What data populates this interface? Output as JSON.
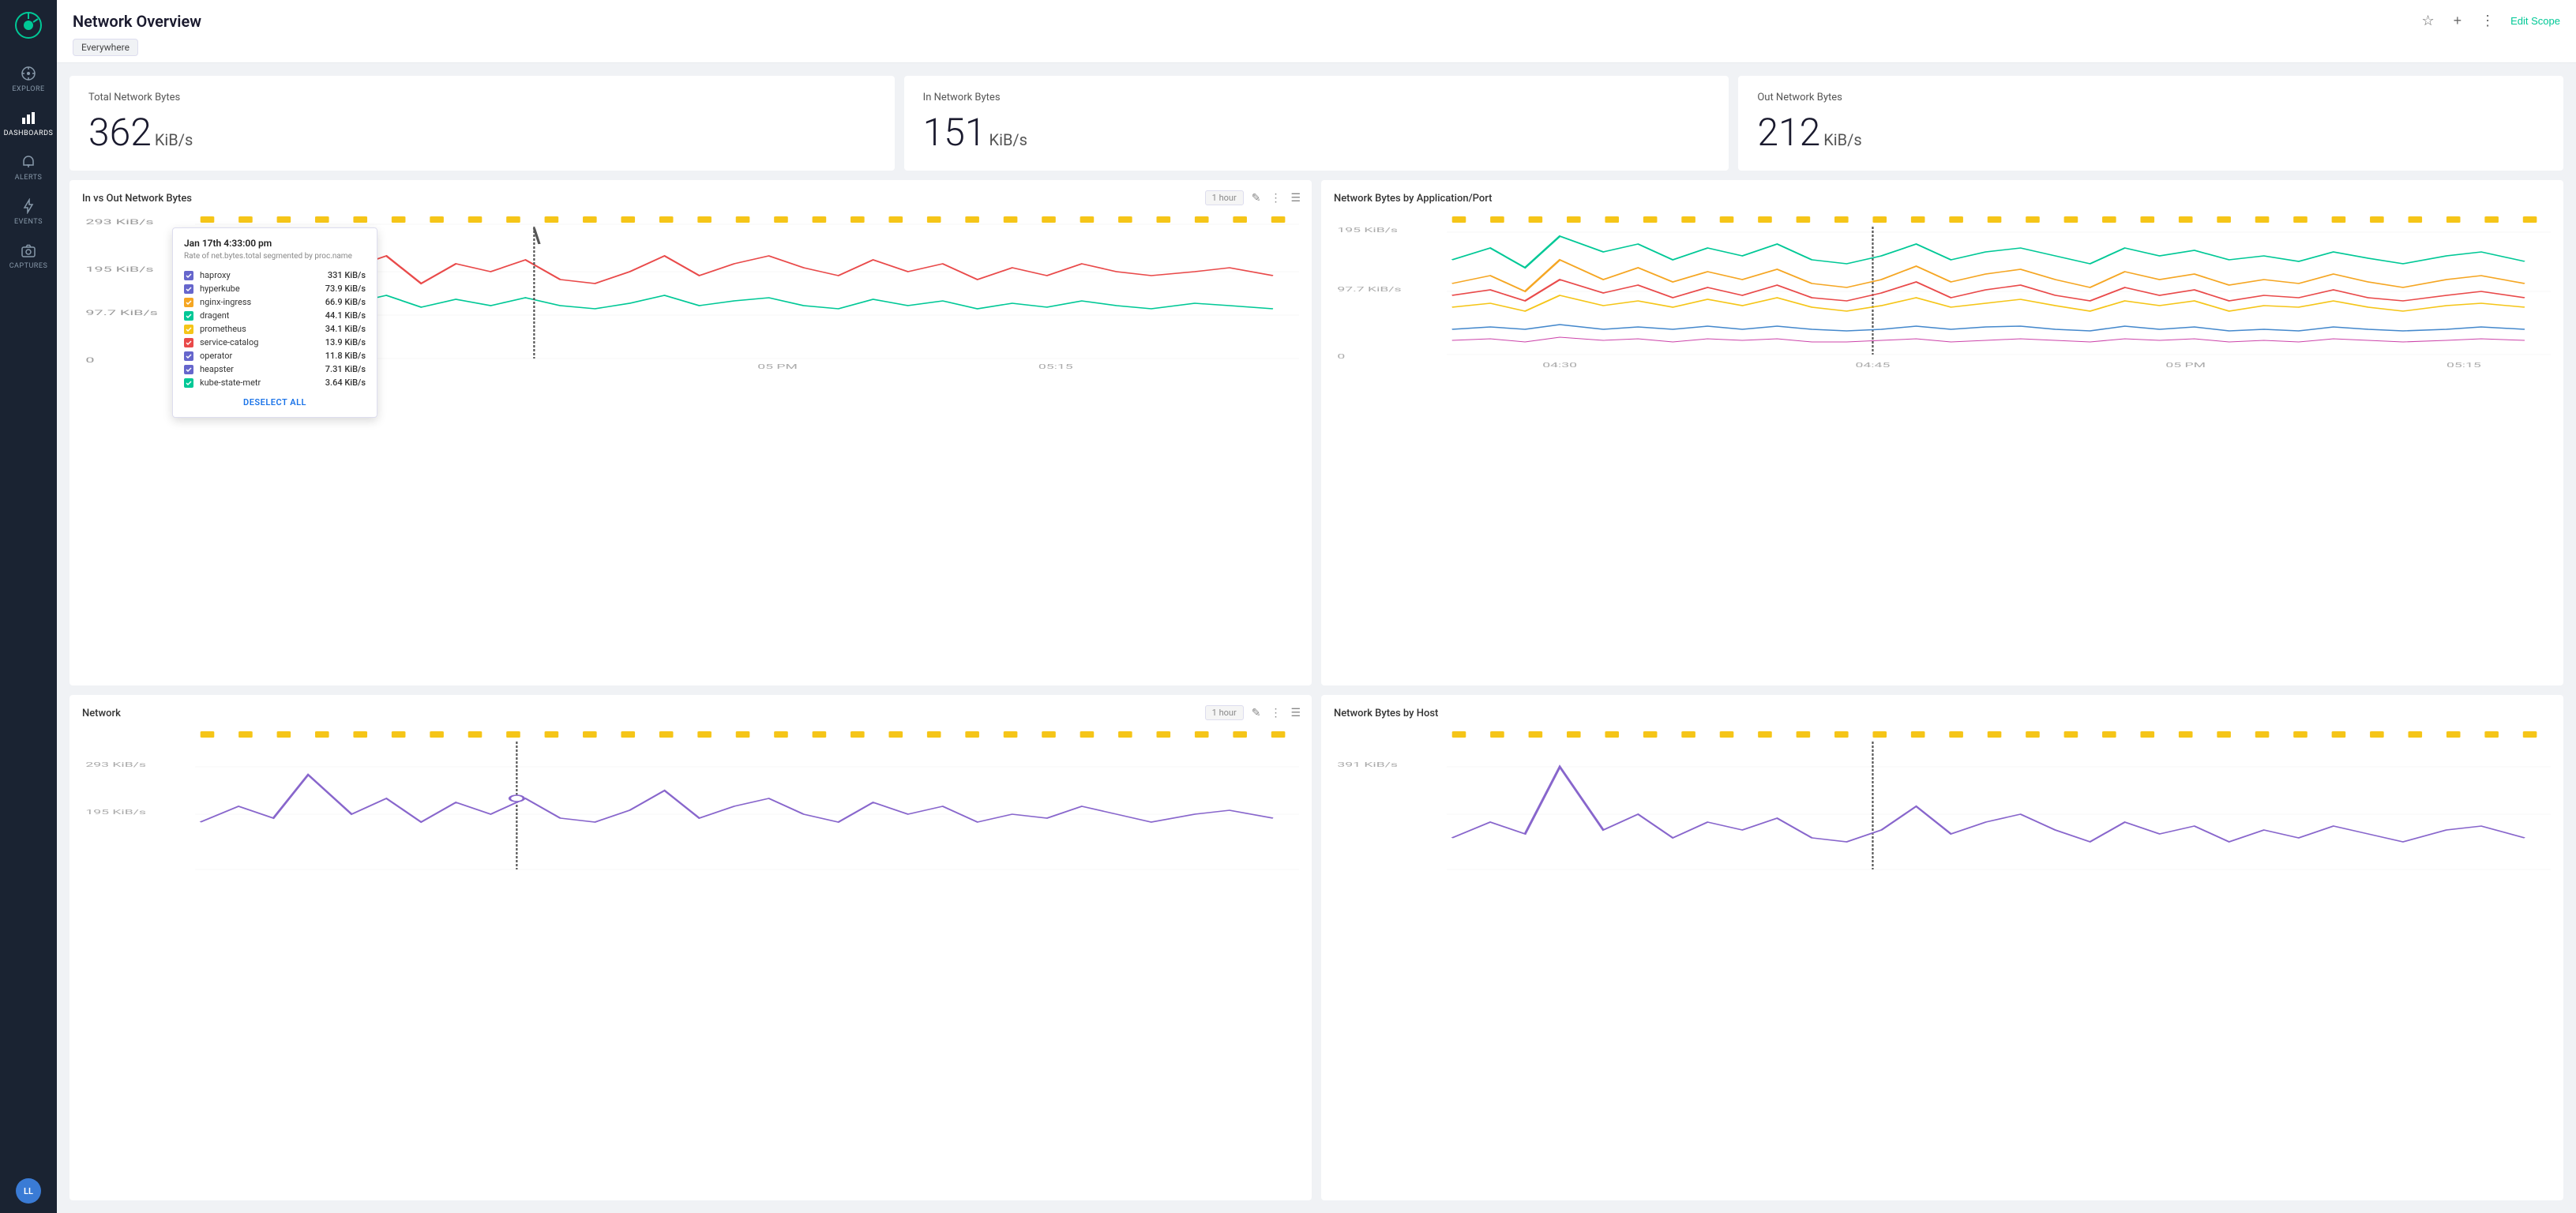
{
  "sidebar": {
    "logo_icon": "tool-icon",
    "items": [
      {
        "id": "explore",
        "label": "EXPLORE",
        "icon": "compass-icon",
        "active": false
      },
      {
        "id": "dashboards",
        "label": "DASHBOARDS",
        "icon": "bar-chart-icon",
        "active": true
      },
      {
        "id": "alerts",
        "label": "ALERTS",
        "icon": "bell-icon",
        "active": false
      },
      {
        "id": "events",
        "label": "EVENTS",
        "icon": "lightning-icon",
        "active": false
      },
      {
        "id": "captures",
        "label": "CAPTURES",
        "icon": "camera-icon",
        "active": false
      }
    ],
    "avatar_initials": "LL"
  },
  "header": {
    "title": "Network Overview",
    "scope": "Everywhere",
    "edit_scope_label": "Edit Scope",
    "star_icon": "star-icon",
    "add_icon": "plus-icon",
    "more_icon": "more-icon"
  },
  "metrics": [
    {
      "id": "total",
      "title": "Total Network Bytes",
      "value": "362",
      "unit": "KiB/s"
    },
    {
      "id": "in",
      "title": "In Network Bytes",
      "value": "151",
      "unit": "KiB/s"
    },
    {
      "id": "out",
      "title": "Out Network Bytes",
      "value": "212",
      "unit": "KiB/s"
    }
  ],
  "charts": {
    "in_vs_out": {
      "title": "In vs Out Network Bytes",
      "time_label": "1 hour",
      "y_labels": [
        "293 KiB/s",
        "195 KiB/s",
        "97.7 KiB/s",
        "0"
      ],
      "x_labels": [
        "",
        "05 PM",
        "05:15"
      ],
      "tooltip": {
        "header": "Jan 17th 4:33:00 pm",
        "subheader": "Rate of net.bytes.total segmented by proc.name",
        "rows": [
          {
            "name": "haproxy",
            "value": "331 KiB/s",
            "color": "#6666cc"
          },
          {
            "name": "hyperkube",
            "value": "73.9 KiB/s",
            "color": "#6666cc"
          },
          {
            "name": "nginx-ingress",
            "value": "66.9 KiB/s",
            "color": "#f5a623"
          },
          {
            "name": "dragent",
            "value": "44.1 KiB/s",
            "color": "#00c896"
          },
          {
            "name": "prometheus",
            "value": "34.1 KiB/s",
            "color": "#f5c518"
          },
          {
            "name": "service-catalog",
            "value": "13.9 KiB/s",
            "color": "#e94a4a"
          },
          {
            "name": "operator",
            "value": "11.8 KiB/s",
            "color": "#6666cc"
          },
          {
            "name": "heapster",
            "value": "7.31 KiB/s",
            "color": "#6666cc"
          },
          {
            "name": "kube-state-metr",
            "value": "3.64 KiB/s",
            "color": "#00c896"
          }
        ],
        "deselect_all": "DESELECT ALL"
      }
    },
    "by_app_port": {
      "title": "Network Bytes by Application/Port",
      "y_labels": [
        "195 KiB/s",
        "97.7 KiB/s",
        "0"
      ],
      "x_labels": [
        "04:30",
        "04:45",
        "05 PM",
        "05:15"
      ]
    },
    "network_proc": {
      "title": "Network",
      "time_label": "1 hour",
      "y_labels": [
        "293 KiB/s",
        "195 KiB/s"
      ]
    },
    "by_host": {
      "title": "Network Bytes by Host",
      "y_labels": [
        "391 KiB/s"
      ]
    }
  }
}
